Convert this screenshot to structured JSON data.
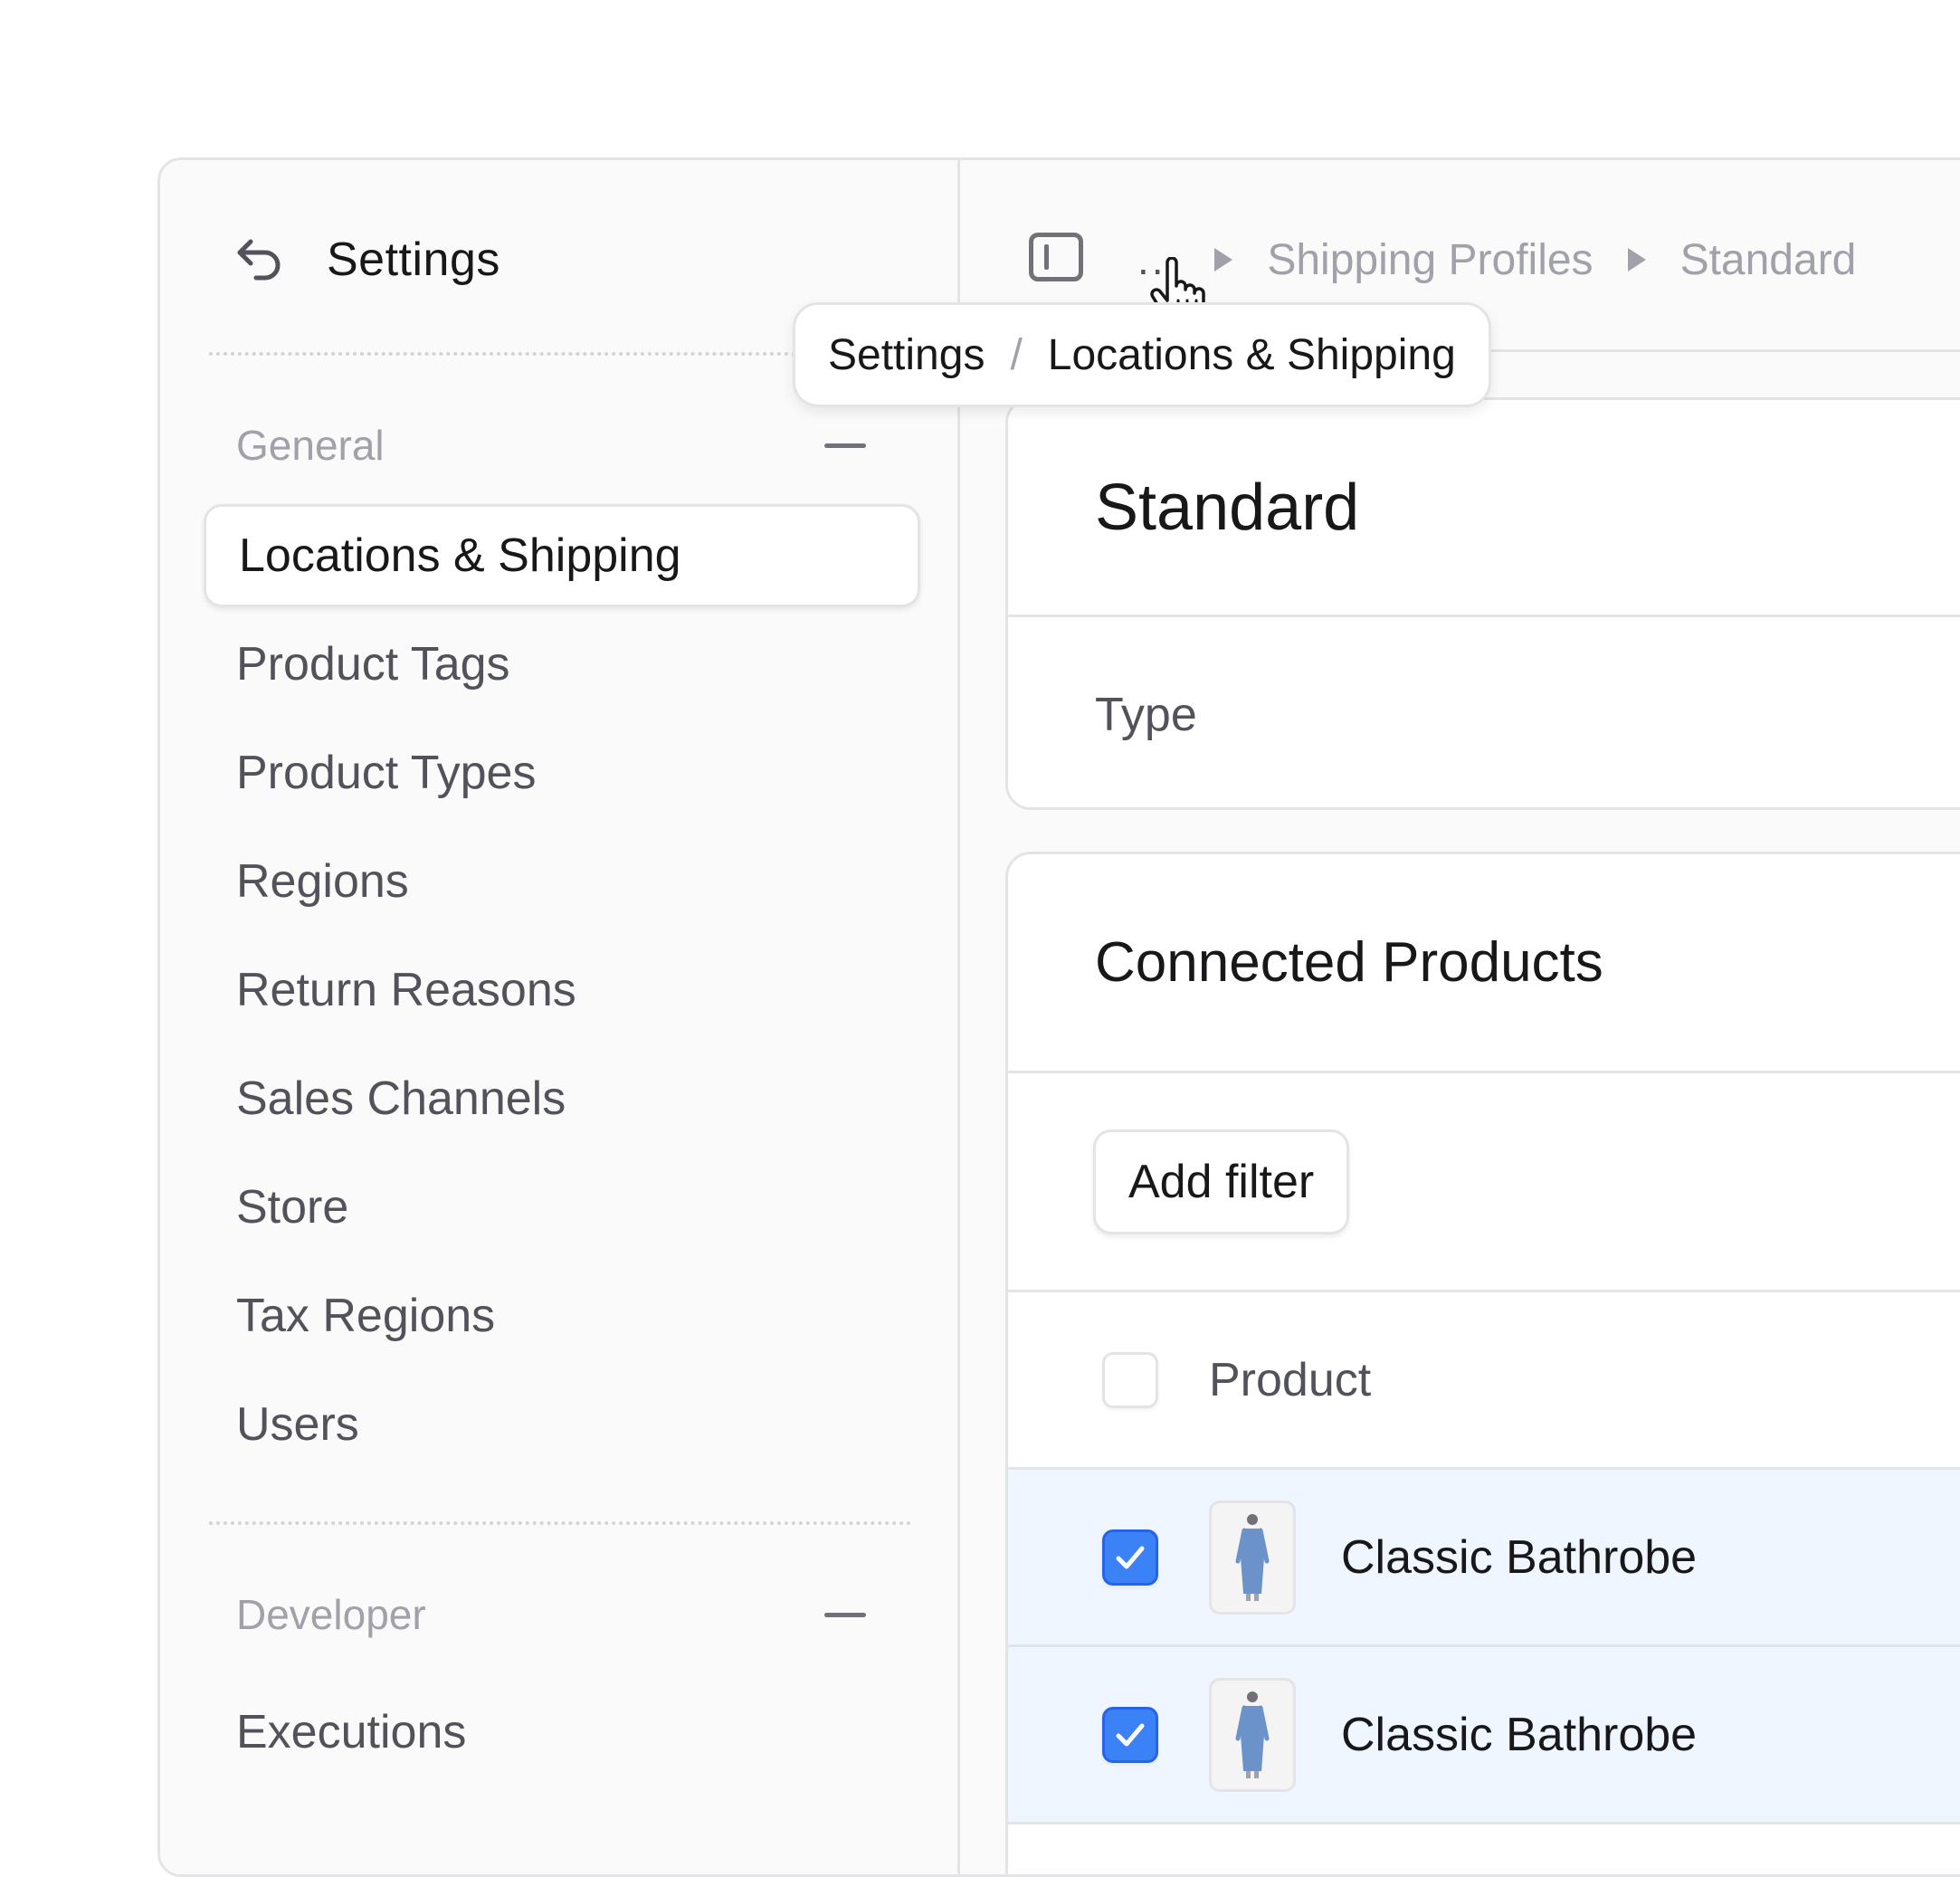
{
  "sidebar": {
    "title": "Settings",
    "general_label": "General",
    "items": [
      {
        "label": "Locations & Shipping",
        "active": true
      },
      {
        "label": "Product Tags"
      },
      {
        "label": "Product Types"
      },
      {
        "label": "Regions"
      },
      {
        "label": "Return Reasons"
      },
      {
        "label": "Sales Channels"
      },
      {
        "label": "Store"
      },
      {
        "label": "Tax Regions"
      },
      {
        "label": "Users"
      }
    ],
    "developer_label": "Developer",
    "developer_items": [
      {
        "label": "Executions"
      }
    ]
  },
  "topbar": {
    "more": "...",
    "crumbs": [
      "Shipping Profiles",
      "Standard"
    ]
  },
  "tooltip": {
    "parts": [
      "Settings",
      "Locations & Shipping"
    ],
    "separator": "/"
  },
  "profile_card": {
    "title": "Standard",
    "type_label": "Type"
  },
  "products_card": {
    "title": "Connected Products",
    "add_filter": "Add filter",
    "column_product": "Product",
    "rows": [
      {
        "name": "Classic Bathrobe",
        "selected": true
      },
      {
        "name": "Classic Bathrobe",
        "selected": true
      }
    ]
  },
  "colors": {
    "accent": "#3b82f6",
    "selected_row": "#eff6ff",
    "border": "#e4e4e7"
  },
  "icons": [
    "back-arrow-icon",
    "sidebar-toggle-icon",
    "collapse-icon",
    "chevron-right-icon",
    "hand-cursor-icon",
    "checkmark-icon",
    "bathrobe-thumbnail"
  ]
}
